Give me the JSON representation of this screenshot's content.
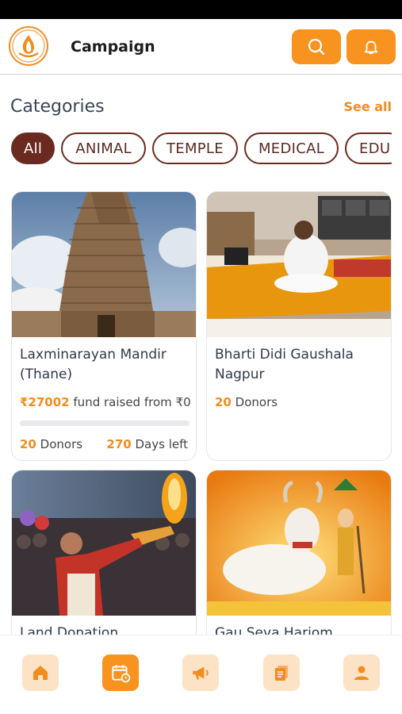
{
  "header": {
    "title": "Campaign",
    "search_icon": "search-icon",
    "bell_icon": "bell-icon",
    "accent": "#f7931e"
  },
  "categories": {
    "title": "Categories",
    "see_all": "See all",
    "chips": [
      "All",
      "ANIMAL",
      "TEMPLE",
      "MEDICAL",
      "EDU"
    ],
    "active": "All"
  },
  "campaigns": [
    {
      "title": "Laxminarayan Mandir (Thane)",
      "raised": "₹27002",
      "raised_suffix": "fund raised from ₹0",
      "progress": 0.0,
      "donors_count": "20",
      "donors_label": "Donors",
      "days_count": "270",
      "days_label": "Days left"
    },
    {
      "title": "Bharti Didi Gaushala Nagpur",
      "donors_count": "20",
      "donors_label": "Donors"
    },
    {
      "title": "Land Donation"
    },
    {
      "title": "Gau Seva Hariom Ashram"
    }
  ],
  "bottom_nav": [
    "home-icon",
    "calendar-icon",
    "megaphone-icon",
    "document-icon",
    "user-icon"
  ],
  "bottom_nav_active": "calendar-icon"
}
